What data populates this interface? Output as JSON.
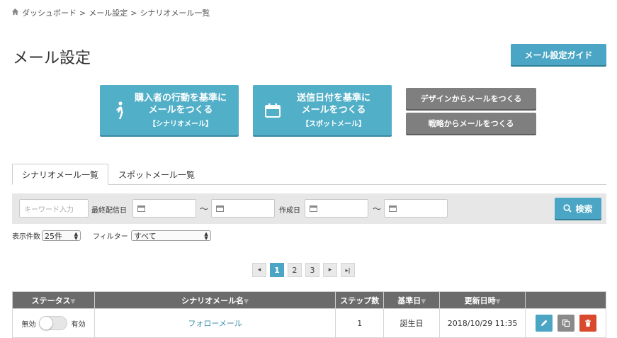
{
  "breadcrumb": {
    "home_icon": "home-icon",
    "items": [
      "ダッシュボード",
      "メール設定",
      "シナリオメール一覧"
    ],
    "sep": ">"
  },
  "page": {
    "title": "メール設定"
  },
  "guide_button": "メール設定ガイド",
  "create_buttons": {
    "scenario": {
      "icon": "walking-person-icon",
      "line1": "購入者の行動を基準に",
      "line2": "メールをつくる",
      "line3": "【シナリオメール】"
    },
    "spot": {
      "icon": "calendar-icon",
      "line1": "送信日付を基準に",
      "line2": "メールをつくる",
      "line3": "【スポットメール】"
    },
    "design": "デザインからメールをつくる",
    "strategy": "戦略からメールをつくる"
  },
  "tabs": [
    "シナリオメール一覧",
    "スポットメール一覧"
  ],
  "filter": {
    "keyword_placeholder": "キーワード入力",
    "last_sent_label": "最終配信日",
    "created_label": "作成日",
    "tilde": "〜",
    "search_label": "検索"
  },
  "options": {
    "count_label": "表示件数",
    "count_value": "25件",
    "filter_label": "フィルター",
    "filter_value": "すべて"
  },
  "pagination": {
    "first": "◂",
    "pages": [
      "1",
      "2",
      "3"
    ],
    "current": "1",
    "next": "▸",
    "last": "▸|"
  },
  "table": {
    "headers": [
      "ステータス",
      "シナリオメール名",
      "ステップ数",
      "基準日",
      "更新日時",
      ""
    ],
    "sort_glyph": "▼",
    "rows": [
      {
        "off_label": "無効",
        "on_label": "有効",
        "enabled": false,
        "name": "フォローメール",
        "steps": "1",
        "base_date": "誕生日",
        "updated": "2018/10/29 11:35"
      }
    ]
  },
  "colors": {
    "accent": "#4aa6c4",
    "create_button": "#52afc8",
    "gray_button": "#7f7f7f",
    "table_header": "#6b6b6b",
    "delete": "#d9492e"
  }
}
